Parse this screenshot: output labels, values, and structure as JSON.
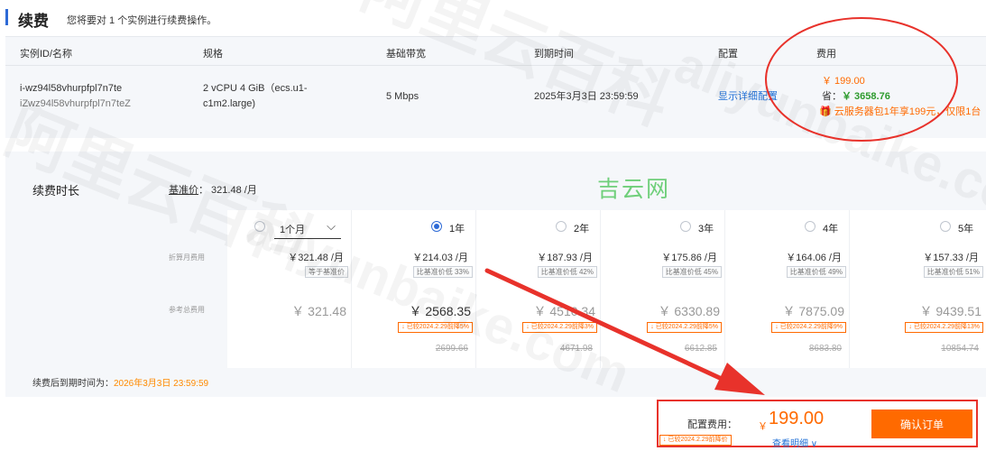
{
  "header": {
    "title": "续费",
    "subtitle": "您将要对 1 个实例进行续费操作。"
  },
  "table": {
    "columns": [
      "实例ID/名称",
      "规格",
      "基础带宽",
      "到期时间",
      "配置",
      "费用"
    ],
    "row": {
      "instance_id": "i-wz94l58vhurpfpl7n7te",
      "instance_name": "iZwz94l58vhurpfpl7n7teZ",
      "spec_line1": "2 vCPU 4 GiB（ecs.u1-",
      "spec_line2": "c1m2.large)",
      "bandwidth": "5 Mbps",
      "expire_time": "2025年3月3日 23:59:59",
      "config_link": "显示详细配置",
      "fee_price": "￥ 199.00",
      "fee_save_label": "省：",
      "fee_save_value": "￥ 3658.76",
      "fee_promo": "🎁 云服务器包1年享199元，仅限1台"
    }
  },
  "duration": {
    "label": "续费时长",
    "base_label": "基准价",
    "base_value": "：  321.48 /月",
    "row_monthly_label": "折算月费用",
    "row_ref_label": "参考总费用",
    "options": [
      {
        "label": "1个月",
        "monthly": "￥321.48 /月",
        "compare": "等于基准价",
        "total": "￥ 321.48",
        "promo": "",
        "strike": "",
        "selected": false
      },
      {
        "label": "1年",
        "monthly": "￥214.03 /月",
        "compare": "比基准价低 33%",
        "total": "￥ 2568.35",
        "promo": "↓ 已较2024.2.29前降5%",
        "strike": "2699.66",
        "selected": true
      },
      {
        "label": "2年",
        "monthly": "￥187.93 /月",
        "compare": "比基准价低 42%",
        "total": "￥ 4510.34",
        "promo": "↓ 已较2024.2.29前降3%",
        "strike": "4671.98",
        "selected": false
      },
      {
        "label": "3年",
        "monthly": "￥175.86 /月",
        "compare": "比基准价低 45%",
        "total": "￥ 6330.89",
        "promo": "↓ 已较2024.2.29前降5%",
        "strike": "6612.85",
        "selected": false
      },
      {
        "label": "4年",
        "monthly": "￥164.06 /月",
        "compare": "比基准价低 49%",
        "total": "￥ 7875.09",
        "promo": "↓ 已较2024.2.29前降9%",
        "strike": "8683.80",
        "selected": false
      },
      {
        "label": "5年",
        "monthly": "￥157.33 /月",
        "compare": "比基准价低 51%",
        "total": "￥ 9439.51",
        "promo": "↓ 已较2024.2.29前降13%",
        "strike": "10854.74",
        "selected": false
      }
    ],
    "expire_label": "续费后到期时间为：",
    "expire_value": "2026年3月3日 23:59:59"
  },
  "footer": {
    "config_fee_label": "配置费用：",
    "currency": "￥",
    "config_fee": "199.00",
    "promo": "↓ 已较2024.2.29前降价",
    "detail_link": "查看明细 ∨",
    "confirm": "确认订单"
  },
  "watermark": {
    "cn": "阿里云百科",
    "en": "aliyunbaike.com",
    "site": "吉云网"
  },
  "colors": {
    "accent": "#ff6a00",
    "link": "#1f6fd6",
    "annotation": "#e8322b",
    "brand_bar": "#2d6ad6"
  }
}
